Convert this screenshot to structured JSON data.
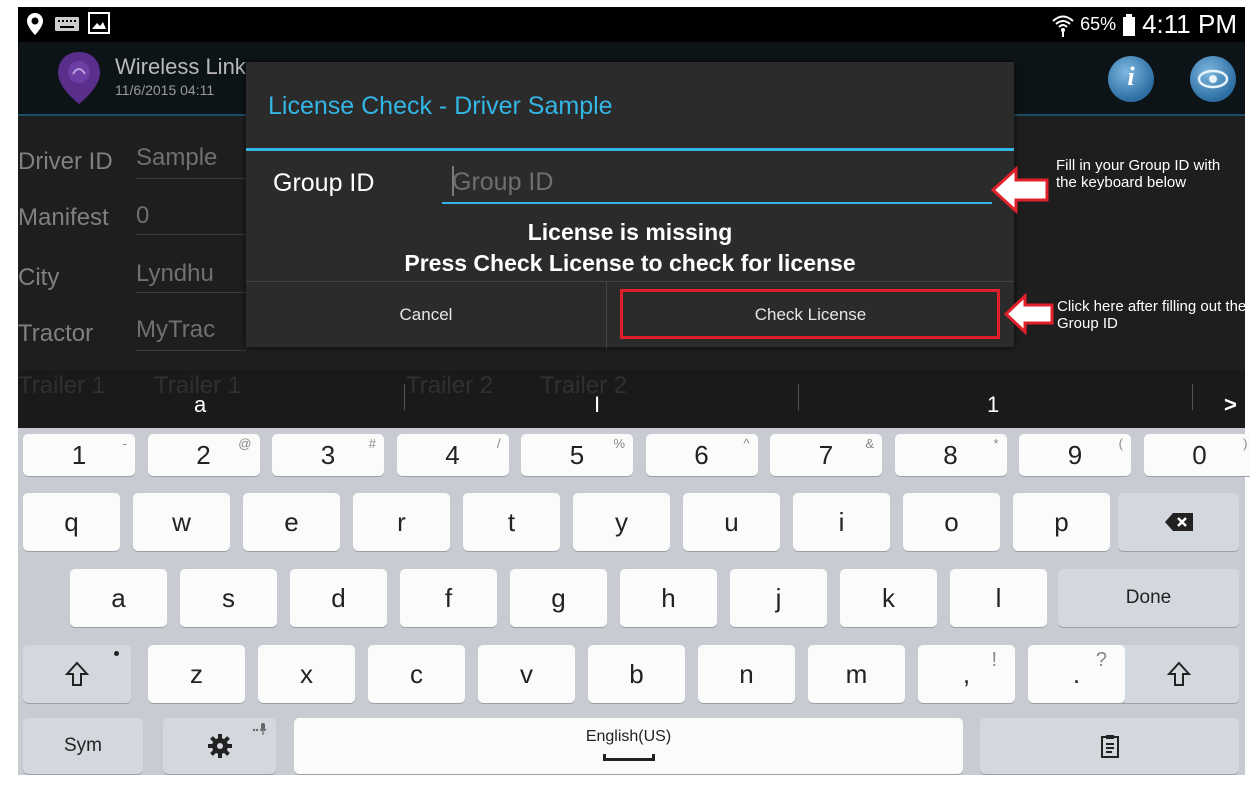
{
  "status_bar": {
    "battery": "65%",
    "time": "4:11 PM"
  },
  "app": {
    "title": "Wireless Link",
    "subtitle": "11/6/2015 04:11",
    "fields": [
      {
        "label": "Driver ID",
        "value": "Sample"
      },
      {
        "label": "Manifest",
        "value": "0"
      },
      {
        "label": "City",
        "value": "Lyndhu"
      },
      {
        "label": "Tractor",
        "value": "MyTrac"
      }
    ],
    "trailers": {
      "t1_label": "Trailer 1",
      "t1_value": "Trailer 1",
      "t2_label": "Trailer 2",
      "t2_value": "Trailer 2"
    }
  },
  "dialog": {
    "title": "License Check - Driver Sample",
    "group_label": "Group ID",
    "group_placeholder": "Group ID",
    "message_line1": "License is missing",
    "message_line2": "Press Check License to check for license",
    "cancel_label": "Cancel",
    "check_label": "Check License"
  },
  "annotations": {
    "note1": "Fill in your Group ID with the keyboard below",
    "note2": "Click here after filling out the Group ID"
  },
  "prediction_bar": {
    "items": [
      "a",
      "I",
      "1"
    ],
    "more": ">"
  },
  "keyboard": {
    "number_row": [
      {
        "key": "1",
        "alt": "-"
      },
      {
        "key": "2",
        "alt": "@"
      },
      {
        "key": "3",
        "alt": "#"
      },
      {
        "key": "4",
        "alt": "/"
      },
      {
        "key": "5",
        "alt": "%"
      },
      {
        "key": "6",
        "alt": "^"
      },
      {
        "key": "7",
        "alt": "&"
      },
      {
        "key": "8",
        "alt": "*"
      },
      {
        "key": "9",
        "alt": "("
      },
      {
        "key": "0",
        "alt": ")"
      }
    ],
    "row1": [
      "q",
      "w",
      "e",
      "r",
      "t",
      "y",
      "u",
      "i",
      "o",
      "p"
    ],
    "row2": [
      "a",
      "s",
      "d",
      "f",
      "g",
      "h",
      "j",
      "k",
      "l"
    ],
    "row3": [
      "z",
      "x",
      "c",
      "v",
      "b",
      "n",
      "m",
      ",",
      "."
    ],
    "row3_alt": {
      "comma": "!",
      "period": "?"
    },
    "done_label": "Done",
    "sym_label": "Sym",
    "space_label": "English(US)",
    "colors": {
      "background": "#c8ccd2",
      "key": "#fbfbfb",
      "dark_key": "#d3d7de"
    }
  },
  "colors": {
    "accent": "#33b5e5",
    "highlight": "#e0202b",
    "dialog": "#2b2b2b"
  }
}
